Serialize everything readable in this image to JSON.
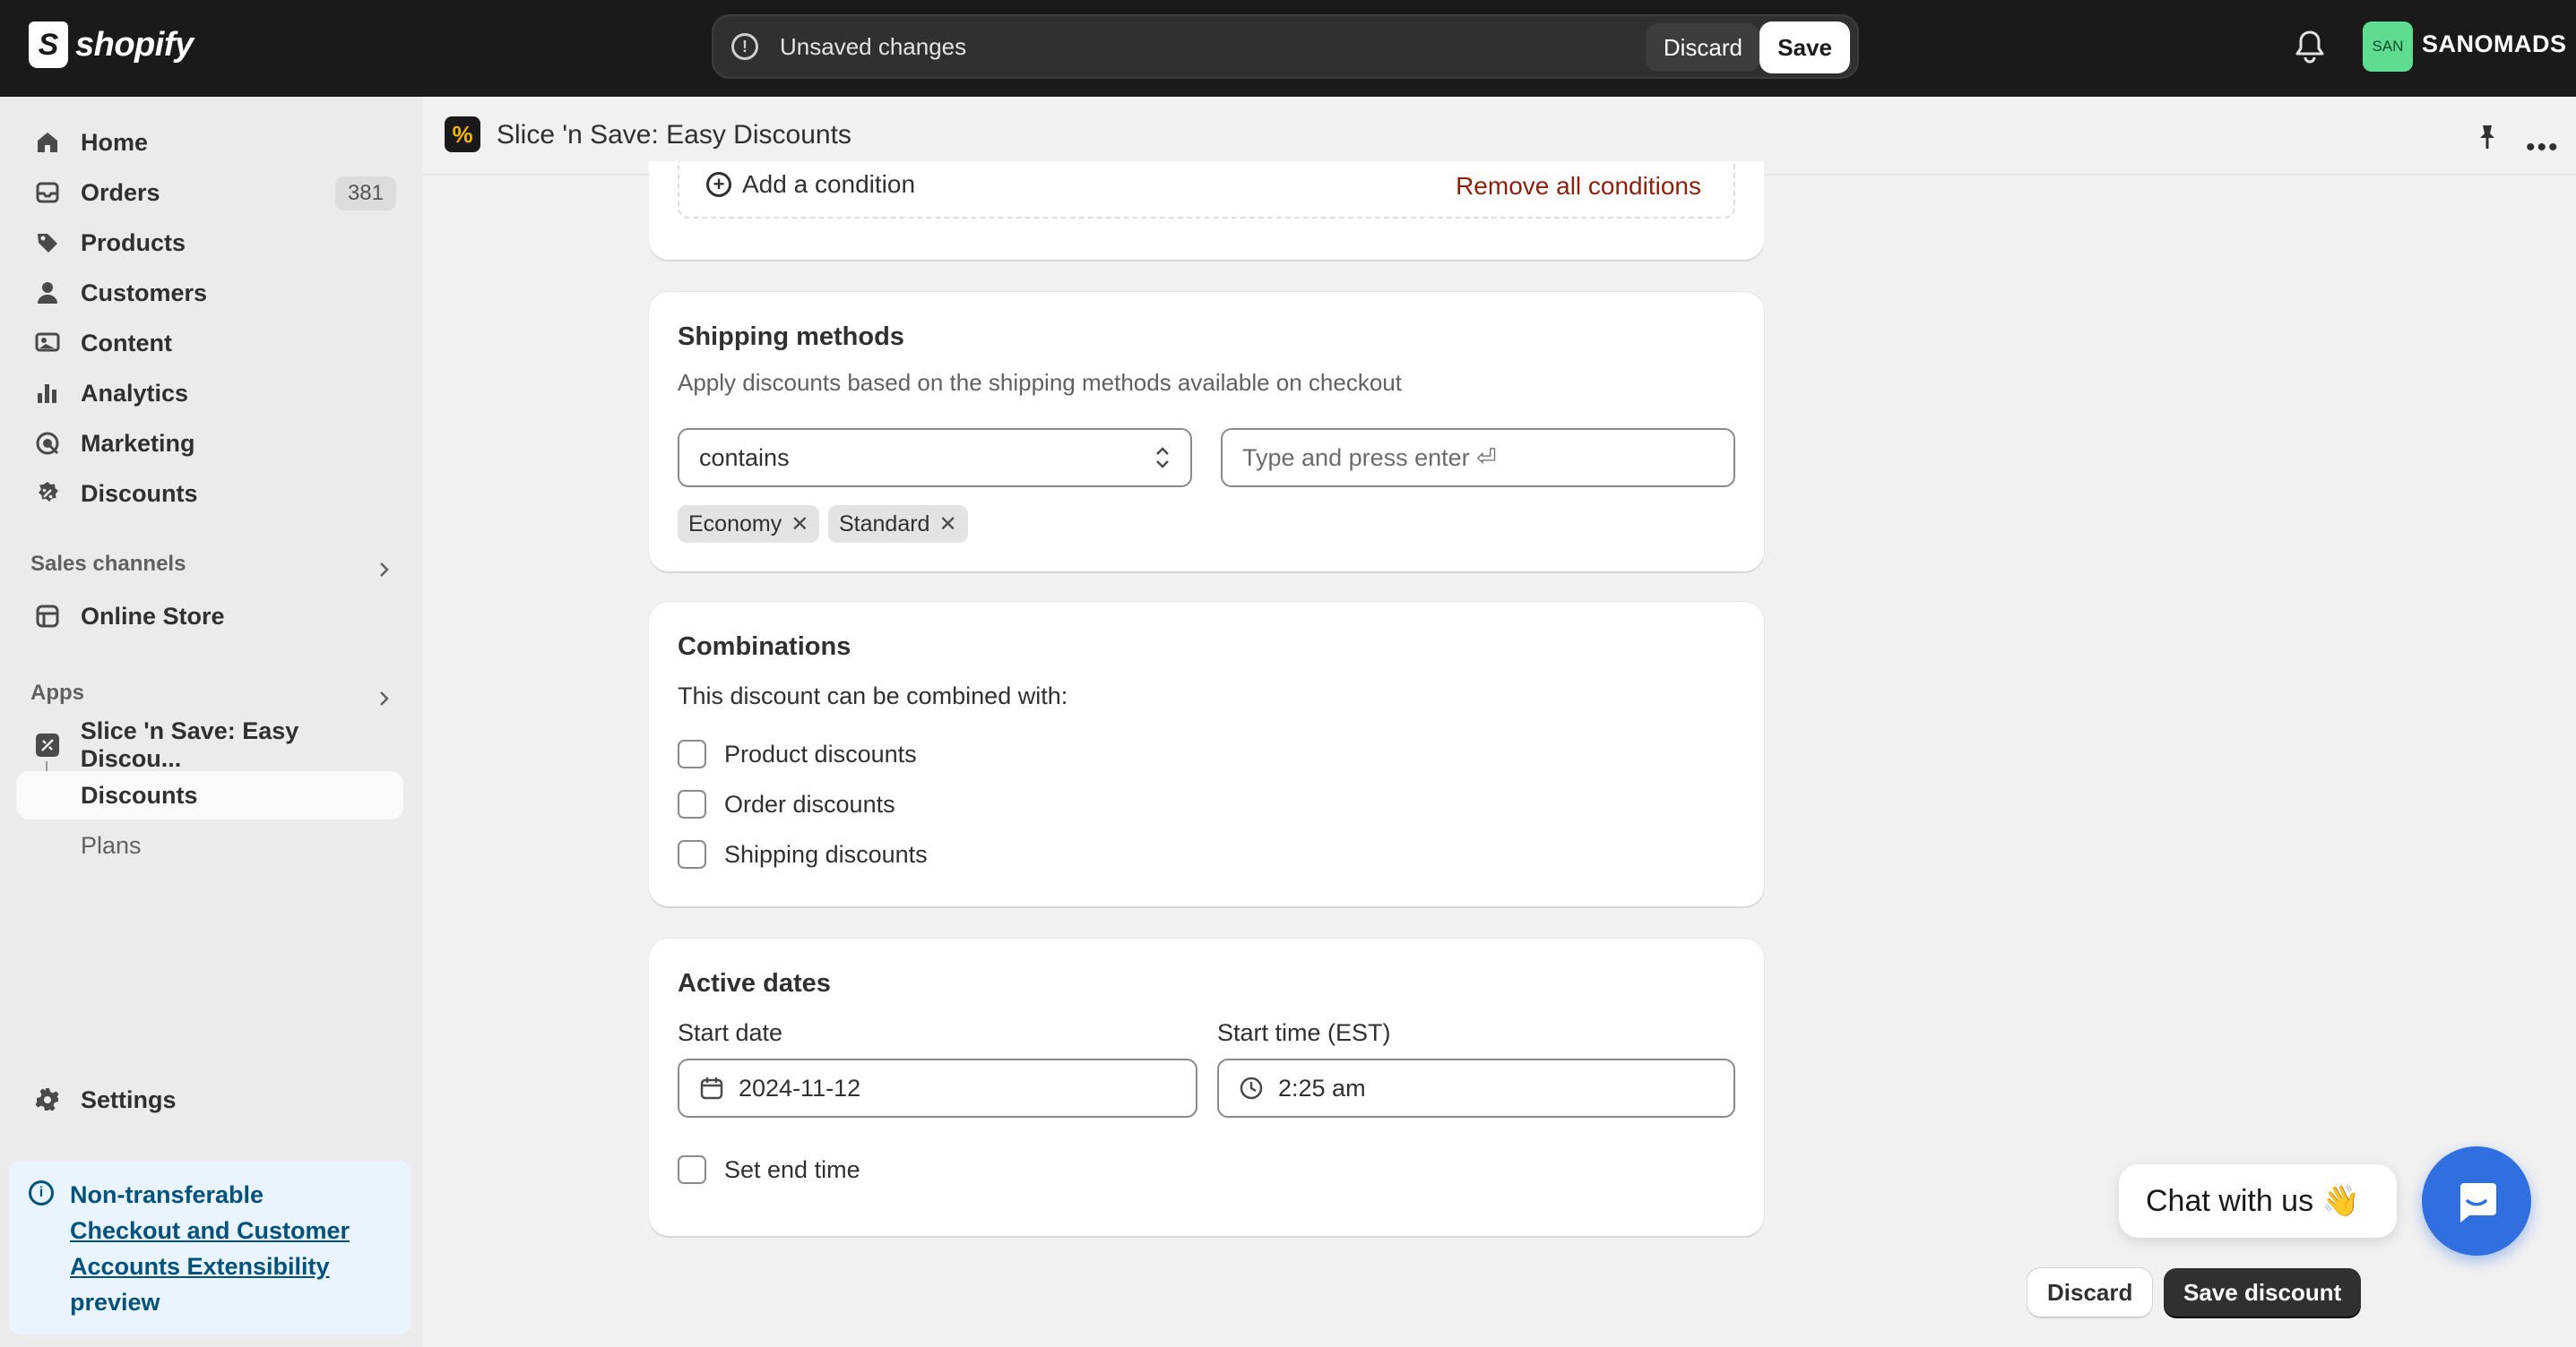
{
  "topbar": {
    "brand": "shopify",
    "unsaved_message": "Unsaved changes",
    "discard_label": "Discard",
    "save_label": "Save",
    "store_initials": "SAN",
    "store_name": "SANOMADS"
  },
  "sidebar": {
    "items": [
      {
        "label": "Home",
        "icon": "home-icon"
      },
      {
        "label": "Orders",
        "icon": "orders-icon",
        "count": "381"
      },
      {
        "label": "Products",
        "icon": "tag-icon"
      },
      {
        "label": "Customers",
        "icon": "person-icon"
      },
      {
        "label": "Content",
        "icon": "content-icon"
      },
      {
        "label": "Analytics",
        "icon": "bar-chart-icon"
      },
      {
        "label": "Marketing",
        "icon": "target-icon"
      },
      {
        "label": "Discounts",
        "icon": "discount-icon"
      }
    ],
    "sales_channels_heading": "Sales channels",
    "online_store_label": "Online Store",
    "apps_heading": "Apps",
    "app_name": "Slice 'n Save: Easy Discou...",
    "app_sub_discounts": "Discounts",
    "app_sub_plans": "Plans",
    "settings_label": "Settings",
    "info": {
      "line1": "Non-transferable",
      "link": "Checkout and Customer Accounts Extensibility",
      "line3": "preview"
    }
  },
  "header": {
    "app_title": "Slice 'n Save: Easy Discounts"
  },
  "conditions": {
    "add_label": "Add a condition",
    "remove_all_label": "Remove all conditions"
  },
  "shipping": {
    "title": "Shipping methods",
    "description": "Apply discounts based on the shipping methods available on checkout",
    "operator": "contains",
    "input_placeholder": "Type and press enter ⏎",
    "tags": [
      "Economy",
      "Standard"
    ]
  },
  "combinations": {
    "title": "Combinations",
    "description": "This discount can be combined with:",
    "options": [
      "Product discounts",
      "Order discounts",
      "Shipping discounts"
    ]
  },
  "active_dates": {
    "title": "Active dates",
    "start_date_label": "Start date",
    "start_date": "2024-11-12",
    "start_time_label": "Start time (EST)",
    "start_time": "2:25 am",
    "end_time_label": "Set end time"
  },
  "footer": {
    "discard_label": "Discard",
    "save_label": "Save discount"
  },
  "chat": {
    "label": "Chat with us 👋"
  },
  "colors": {
    "topbar_bg": "#1a1a1a",
    "accent_red": "#8e1f0b",
    "chat_blue": "#2f6fe0",
    "store_badge": "#5edc8f"
  }
}
